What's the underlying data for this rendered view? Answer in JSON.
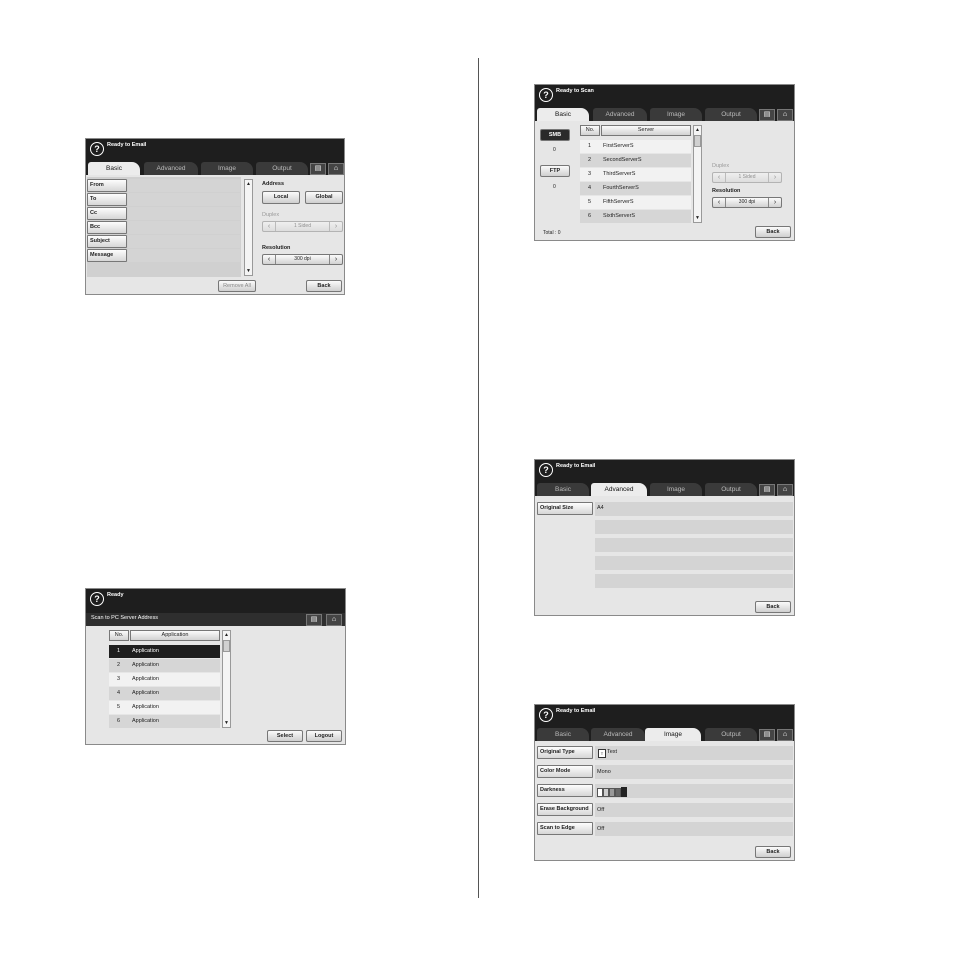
{
  "s1": {
    "title": "Ready to Email",
    "tabs": [
      "Basic",
      "Advanced",
      "Image",
      "Output"
    ],
    "fields": [
      "From",
      "To",
      "Cc",
      "Bcc",
      "Subject",
      "Message"
    ],
    "address_label": "Address",
    "local": "Local",
    "global": "Global",
    "duplex_label": "Duplex",
    "duplex_value": "1 Sided",
    "resolution_label": "Resolution",
    "resolution_value": "300 dpi",
    "remove_all": "Remove All",
    "back": "Back"
  },
  "s2": {
    "title": "Ready to Scan",
    "tabs": [
      "Basic",
      "Advanced",
      "Image",
      "Output"
    ],
    "smb": "SMB",
    "smb_count": "0",
    "ftp": "FTP",
    "ftp_count": "0",
    "col_no": "No.",
    "col_server": "Server",
    "rows": [
      {
        "no": "1",
        "name": "FirstServerS"
      },
      {
        "no": "2",
        "name": "SecondServerS"
      },
      {
        "no": "3",
        "name": "ThirdServerS"
      },
      {
        "no": "4",
        "name": "FourthServerS"
      },
      {
        "no": "5",
        "name": "FifthServerS"
      },
      {
        "no": "6",
        "name": "SixthServerS"
      }
    ],
    "duplex_label": "Duplex",
    "duplex_value": "1 Sided",
    "resolution_label": "Resolution",
    "resolution_value": "300 dpi",
    "total": "Total : 0",
    "back": "Back"
  },
  "s3": {
    "title": "Ready",
    "subtitle": "Scan to PC Server Address",
    "col_no": "No.",
    "col_app": "Application",
    "rows": [
      {
        "no": "1",
        "name": "Application"
      },
      {
        "no": "2",
        "name": "Application"
      },
      {
        "no": "3",
        "name": "Application"
      },
      {
        "no": "4",
        "name": "Application"
      },
      {
        "no": "5",
        "name": "Application"
      },
      {
        "no": "6",
        "name": "Application"
      }
    ],
    "select": "Select",
    "logout": "Logout"
  },
  "s4": {
    "title": "Ready to Email",
    "tabs": [
      "Basic",
      "Advanced",
      "Image",
      "Output"
    ],
    "original_size": "Original Size",
    "original_size_value": "A4",
    "back": "Back"
  },
  "s5": {
    "title": "Ready to Email",
    "tabs": [
      "Basic",
      "Advanced",
      "Image",
      "Output"
    ],
    "settings": [
      {
        "label": "Original Type",
        "value": "Text"
      },
      {
        "label": "Color Mode",
        "value": "Mono"
      },
      {
        "label": "Darkness",
        "value": ""
      },
      {
        "label": "Erase Background",
        "value": "Off"
      },
      {
        "label": "Scan to Edge",
        "value": "Off"
      }
    ],
    "back": "Back"
  }
}
